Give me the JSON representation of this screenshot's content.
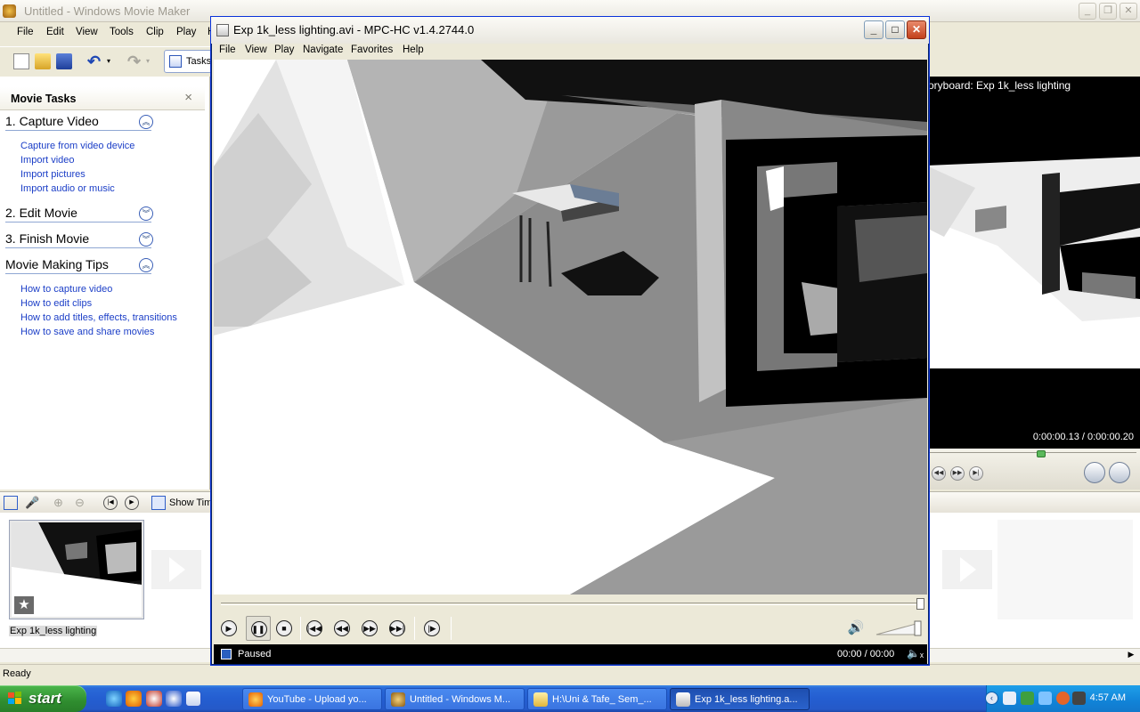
{
  "wmm": {
    "title": "Untitled - Windows Movie Maker",
    "menu": [
      "File",
      "Edit",
      "View",
      "Tools",
      "Clip",
      "Play",
      "H"
    ],
    "toolbar": {
      "tasks_label": "Tasks"
    },
    "tasks_pane": {
      "title": "Movie Tasks",
      "close": "×",
      "sections": [
        {
          "title": "1. Capture Video",
          "links": [
            "Capture from video device",
            "Import video",
            "Import pictures",
            "Import audio or music"
          ]
        },
        {
          "title": "2. Edit Movie",
          "links": []
        },
        {
          "title": "3. Finish Movie",
          "links": []
        },
        {
          "title": "Movie Making Tips",
          "links": [
            "How to capture video",
            "How to edit clips",
            "How to add titles, effects, transitions",
            "How to save and share movies"
          ]
        }
      ]
    },
    "preview": {
      "title": "oryboard: Exp 1k_less lighting",
      "time": "0:00:00.13 / 0:00:00.20"
    },
    "timeline": {
      "show_label": "Show Tim"
    },
    "clip": {
      "name": "Exp 1k_less lighting"
    },
    "status": "Ready"
  },
  "mpc": {
    "title": "Exp 1k_less lighting.avi - MPC-HC v1.4.2744.0",
    "menu": [
      "File",
      "View",
      "Play",
      "Navigate",
      "Favorites",
      "Help"
    ],
    "status": {
      "state": "Paused",
      "time": "00:00 / 00:00",
      "mute_icon": "🔈ₓ"
    }
  },
  "taskbar": {
    "start": "start",
    "tasks": [
      {
        "label": "YouTube - Upload yo...",
        "color": "#e66000"
      },
      {
        "label": "Untitled - Windows M...",
        "color": "#d9a32c"
      },
      {
        "label": "H:\\Uni & Tafe_ Sem_...",
        "color": "#e8c552"
      },
      {
        "label": "Exp 1k_less lighting.a...",
        "color": "#d8d8d8",
        "active": true
      }
    ],
    "clock": "4:57 AM"
  }
}
